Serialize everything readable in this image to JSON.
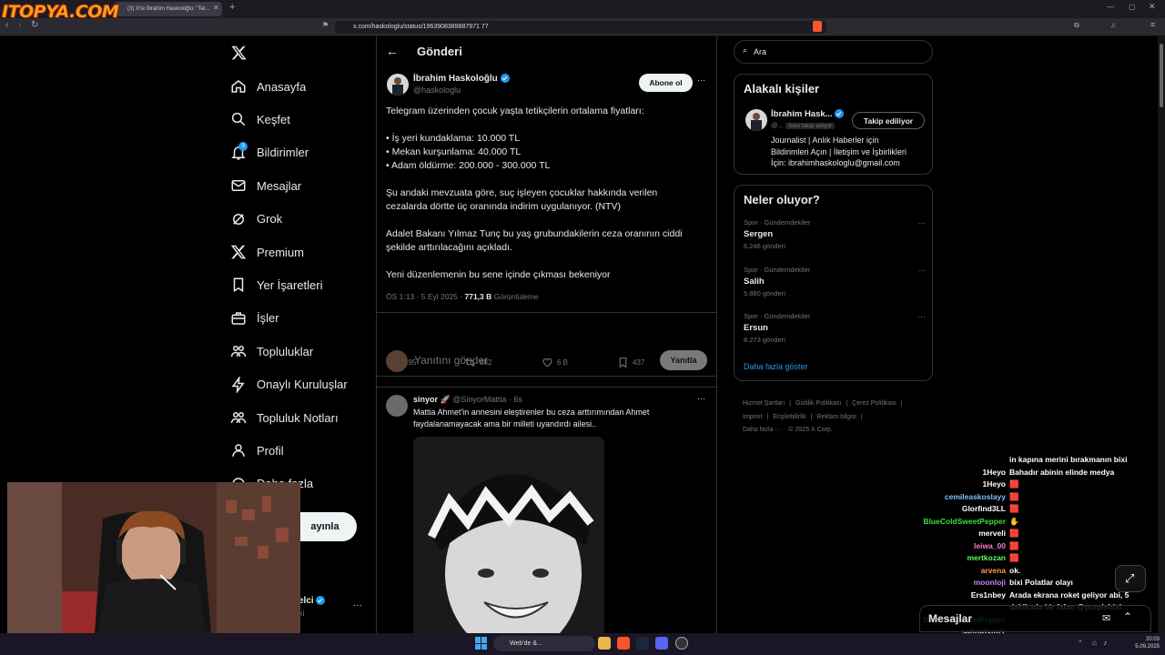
{
  "watermark": "ITOPYA.COM",
  "browser": {
    "tab_title": "(3) X'te İbrahim Haskoloğlu: \"Tel...",
    "url": "x.com/haskologlu/status/1963908389887971 77"
  },
  "nav": {
    "items": [
      {
        "label": "Anasayfa",
        "icon": "home-icon"
      },
      {
        "label": "Keşfet",
        "icon": "search-icon"
      },
      {
        "label": "Bildirimler",
        "icon": "bell-icon",
        "badge": "3"
      },
      {
        "label": "Mesajlar",
        "icon": "mail-icon"
      },
      {
        "label": "Grok",
        "icon": "grok-icon"
      },
      {
        "label": "Premium",
        "icon": "x-logo-icon"
      },
      {
        "label": "Yer İşaretleri",
        "icon": "bookmark-icon"
      },
      {
        "label": "İşler",
        "icon": "briefcase-icon"
      },
      {
        "label": "Topluluklar",
        "icon": "people-icon"
      },
      {
        "label": "Onaylı Kuruluşlar",
        "icon": "bolt-icon"
      },
      {
        "label": "Topluluk Notları",
        "icon": "notes-icon"
      },
      {
        "label": "Profil",
        "icon": "person-icon"
      },
      {
        "label": "Daha fazla",
        "icon": "more-circle-icon"
      }
    ],
    "post_button": "ayınla",
    "account_name_fragment": "elci",
    "account_handle_fragment": "xi"
  },
  "header": {
    "title": "Gönderi"
  },
  "tweet": {
    "author_name": "İbrahim Haskoloğlu",
    "author_handle": "@haskologlu",
    "follow_button": "Abone ol",
    "lines": [
      "Telegram üzerinden çocuk yaşta tetikçilerin ortalama fiyatları:",
      "",
      "• İş yeri kundaklama: 10.000 TL",
      "• Mekan kurşunlama: 40.000 TL",
      "• Adam öldürme: 200.000 - 300.000 TL",
      "",
      "Şu andaki mevzuata göre, suç işleyen çocuklar hakkında verilen",
      "cezalarda dörtte üç oranında indirim uygulanıyor. (NTV)",
      "",
      "Adalet Bakanı Yılmaz Tunç bu yaş grubundakilerin ceza oranının ciddi",
      "şekilde arttırılacağını açıkladı.",
      "",
      "Yeni düzenlemenin bu sene içinde çıkması bekeniyor"
    ],
    "time": "ÖS 1:13 · 5 Eyl 2025 ·",
    "views_count": "771,3 B",
    "views_label": "Görüntüleme",
    "replies": "295",
    "reposts": "882",
    "likes": "6 B",
    "bookmarks": "437"
  },
  "reply_box": {
    "placeholder": "Yanıtını gönder",
    "button": "Yanıtla"
  },
  "reply": {
    "author_name": "sinyor",
    "author_handle": "@SinyorMattia · 6s",
    "text_line1": "Mattia Ahmet'in annesini eleştirenler bu ceza arttırımından Ahmet",
    "text_line2": "faydalanamayacak ama bir milleti uyandırdı ailesi.."
  },
  "search": {
    "placeholder": "Ara"
  },
  "related": {
    "title": "Alakalı kişiler",
    "name": "İbrahim Hask...",
    "handle": "@...",
    "follows_you": "Seni takip ediyor",
    "button": "Takip ediliyor",
    "bio_lines": [
      "Journalist | Anlık Haberler için",
      "Bildirimleri Açın | İletişim ve İşbirlikleri",
      "İçin: ibrahimhaskologlu@gmail.com"
    ]
  },
  "trends": {
    "title": "Neler oluyor?",
    "items": [
      {
        "category": "Spor · Gündemdekiler",
        "name": "Sergen",
        "count": "6.246 gönderi"
      },
      {
        "category": "Spor · Gündemdekiler",
        "name": "Salih",
        "count": "5.880 gönderi"
      },
      {
        "category": "Spor · Gündemdekiler",
        "name": "Ersun",
        "count": "8.273 gönderi"
      }
    ],
    "show_more": "Daha fazla göster"
  },
  "footer": {
    "row1": [
      "Hizmet Şartları",
      "Gizlilik Politikası",
      "Çerez Politikası"
    ],
    "row2": [
      "Imprint",
      "Erişilebilirlik",
      "Reklam bilgisi"
    ],
    "more": "Daha fazla ···",
    "copyright": "© 2025 X Corp."
  },
  "chat": [
    {
      "user": "",
      "msg": "in kapına merini bırakmanın bixi",
      "color": "#7fd6ff"
    },
    {
      "user": "1Heyo",
      "msg": "Bahadır abinin elinde medya",
      "color": "#ffffff"
    },
    {
      "user": "1Heyo",
      "msg": "🟥",
      "color": "#ffffff"
    },
    {
      "user": "cemileaskoslayy",
      "msg": "🟥",
      "color": "#7fc1ff"
    },
    {
      "user": "Glorfind3LL",
      "msg": "🟥",
      "color": "#ffffff"
    },
    {
      "user": "BlueColdSweetPepper",
      "msg": "✋",
      "color": "#3ce03c"
    },
    {
      "user": "merveli",
      "msg": "🟥",
      "color": "#ffffff"
    },
    {
      "user": "leiwa_00",
      "msg": "🟥",
      "color": "#ff7acb"
    },
    {
      "user": "mertkozan",
      "msg": "🟥",
      "color": "#5cff5c"
    },
    {
      "user": "arvena",
      "msg": "ok.",
      "color": "#ff9b3d"
    },
    {
      "user": "moonloji",
      "msg": "bixi Polatlar olayı",
      "color": "#c387ff"
    },
    {
      "user": "Ers1nbey",
      "msg": "Arada ekrana roket geliyor abi, 5",
      "color": "#ffffff"
    },
    {
      "user": "",
      "msg": "dakikada bir falan @purplebixi",
      "color": "#ffffff"
    },
    {
      "user": "BlueColdSweetPepper",
      "msg": "",
      "color": "#3ce03c"
    },
    {
      "user": "sahradymzz",
      "msg": "",
      "color": "#ffffff"
    }
  ],
  "messages_drawer": {
    "label": "Mesajlar"
  },
  "taskbar": {
    "search": "Web'de &...",
    "clock_time": "20:03",
    "clock_date": "5.09.2025"
  }
}
